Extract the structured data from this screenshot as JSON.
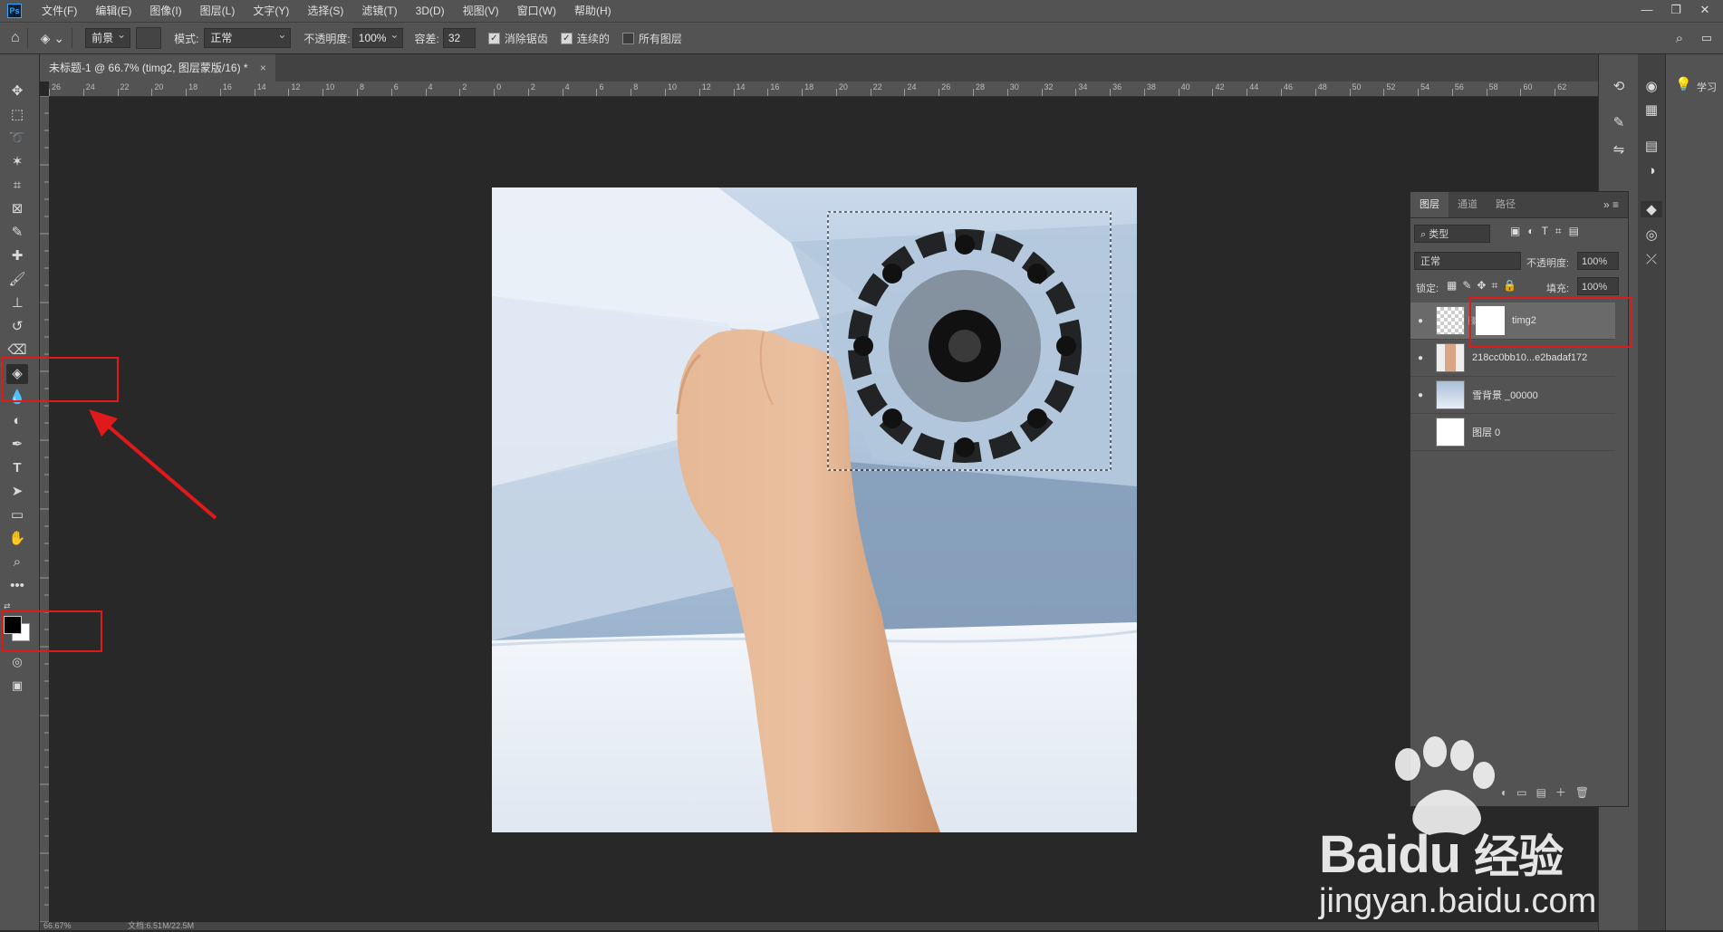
{
  "menubar": {
    "app_icon": "Ps",
    "items": [
      "文件(F)",
      "编辑(E)",
      "图像(I)",
      "图层(L)",
      "文字(Y)",
      "选择(S)",
      "滤镜(T)",
      "3D(D)",
      "视图(V)",
      "窗口(W)",
      "帮助(H)"
    ],
    "window_controls": [
      "—",
      "❐",
      "✕"
    ]
  },
  "options_bar": {
    "fill_source": "前景",
    "mode_label": "模式:",
    "mode_value": "正常",
    "opacity_label": "不透明度:",
    "opacity_value": "100%",
    "tolerance_label": "容差:",
    "tolerance_value": "32",
    "antialias_label": "消除锯齿",
    "contiguous_label": "连续的",
    "all_layers_label": "所有图层"
  },
  "document": {
    "tab_title": "未标题-1 @ 66.7% (timg2, 图层蒙版/16) *",
    "close": "×"
  },
  "ruler_top_labels": [
    "26",
    "24",
    "22",
    "20",
    "18",
    "16",
    "14",
    "12",
    "10",
    "8",
    "6",
    "4",
    "2",
    "0",
    "2",
    "4",
    "6",
    "8",
    "10",
    "12",
    "14",
    "16",
    "18",
    "20",
    "22",
    "24",
    "26",
    "28",
    "30",
    "32",
    "34",
    "36",
    "38",
    "40",
    "42",
    "44",
    "46",
    "48",
    "50",
    "52",
    "54",
    "56",
    "58",
    "60",
    "62"
  ],
  "layers_panel": {
    "tabs": [
      "图层",
      "通道",
      "路径"
    ],
    "filter_label": "类型",
    "blend_mode": "正常",
    "opacity_label": "不透明度:",
    "opacity_value": "100%",
    "lock_label": "锁定:",
    "fill_label": "填充:",
    "fill_value": "100%",
    "layers": [
      {
        "name": "timg2",
        "visible": true,
        "selected": true
      },
      {
        "name": "218cc0bb10...e2badaf172",
        "visible": true,
        "selected": false
      },
      {
        "name": "雪背景 _00000",
        "visible": true,
        "selected": false
      },
      {
        "name": "图层 0",
        "visible": false,
        "selected": false
      }
    ]
  },
  "learn_panel": {
    "label": "学习"
  },
  "status": {
    "zoom": "66.67%",
    "doc_info": "文档:6.51M/22.5M"
  },
  "watermark": {
    "brand": "Baidu",
    "brand_cn": "经验",
    "url": "jingyan.baidu.com"
  },
  "colors": {
    "foreground": "#000000",
    "background": "#ffffff",
    "annotation_red": "#e01a1a"
  }
}
